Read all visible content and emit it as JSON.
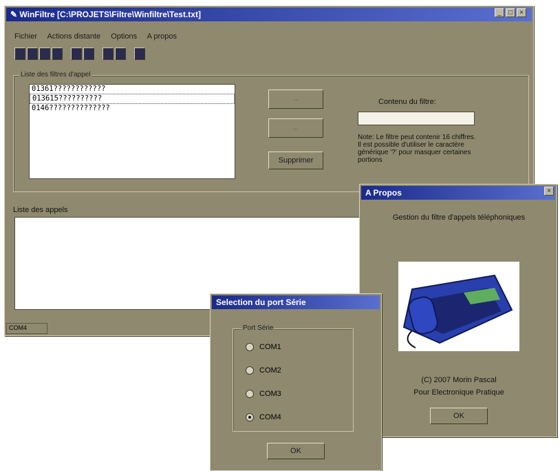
{
  "main": {
    "title": "WinFiltre [C:\\PROJETS\\Filtre\\Winfiltre\\Test.txt]",
    "menu": [
      "Fichier",
      "Actions distante",
      "Options",
      "A propos"
    ],
    "filters_group_label": "Liste des filtres d'appel",
    "filters": [
      "01361????????????",
      "013615??????????",
      "0146??????????????"
    ],
    "delete_button": "Supprimer",
    "content_label": "Contenu du filtre:",
    "content_value": "",
    "note": "Note: Le filtre peut contenir 16 chiffres. Il est possible d'utiliser le caractère générique '?' pour masquer certaines portions",
    "calls_label": "Liste des appels",
    "status": "COM4"
  },
  "about": {
    "title": "A Propos",
    "heading": "Gestion du filtre d'appels téléphoniques",
    "copyright": "(C) 2007 Morin Pascal",
    "publication": "Pour Electronique Pratique",
    "ok": "OK",
    "close": "×"
  },
  "serial": {
    "title": "Selection du port Série",
    "group_label": "Port Série",
    "options": [
      "COM1",
      "COM2",
      "COM3",
      "COM4"
    ],
    "selected": "COM4",
    "ok": "OK"
  },
  "colors": {
    "dialog_bg": "#8f8a6f",
    "titlebar": "#1b2a8a"
  }
}
